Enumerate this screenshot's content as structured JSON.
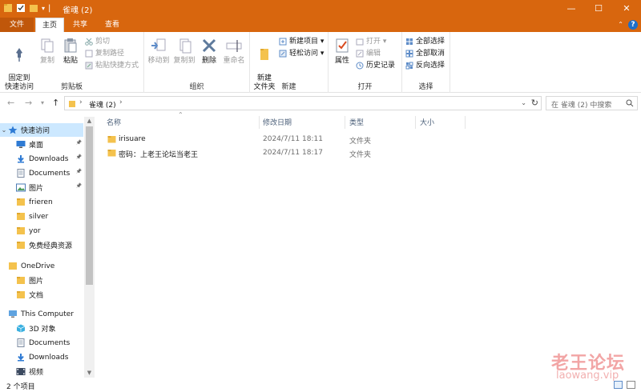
{
  "window": {
    "title": "雀魂 (2)",
    "minimize": "—",
    "maximize": "☐",
    "close": "✕"
  },
  "tabs": [
    "文件",
    "主页",
    "共享",
    "查看"
  ],
  "help": "?",
  "ribbon": {
    "clipboard": {
      "label": "剪贴板",
      "pin": "固定到\n快速访问",
      "copy": "复制",
      "paste": "粘贴",
      "cut": "剪切",
      "copy_path": "复制路径",
      "paste_shortcut": "粘贴快捷方式"
    },
    "organize": {
      "label": "组织",
      "move_to": "移动到",
      "copy_to": "复制到",
      "delete": "删除",
      "rename": "重命名"
    },
    "new": {
      "label": "新建",
      "new_folder": "新建\n文件夹",
      "new_item": "新建项目 ▾",
      "easy_access": "轻松访问 ▾"
    },
    "open": {
      "label": "打开",
      "properties": "属性",
      "open": "打开 ▾",
      "edit": "编辑",
      "history": "历史记录"
    },
    "select": {
      "label": "选择",
      "select_all": "全部选择",
      "select_none": "全部取消",
      "invert": "反向选择"
    }
  },
  "address": {
    "path": "雀魂 (2)",
    "search_placeholder": "在 雀魂 (2) 中搜索"
  },
  "nav": {
    "quick_access": "快速访问",
    "quick_items": [
      {
        "label": "桌面",
        "icon": "desktop-icon",
        "pinned": true
      },
      {
        "label": "Downloads",
        "icon": "download-icon",
        "pinned": true
      },
      {
        "label": "Documents",
        "icon": "documents-icon",
        "pinned": true
      },
      {
        "label": "图片",
        "icon": "pictures-icon",
        "pinned": true
      },
      {
        "label": "frieren",
        "icon": "folder-icon",
        "pinned": false
      },
      {
        "label": "silver",
        "icon": "folder-icon",
        "pinned": false
      },
      {
        "label": "yor",
        "icon": "folder-icon",
        "pinned": false
      },
      {
        "label": "免费经典资源",
        "icon": "folder-icon",
        "pinned": false
      }
    ],
    "onedrive": "OneDrive",
    "onedrive_items": [
      {
        "label": "图片",
        "icon": "folder-icon"
      },
      {
        "label": "文档",
        "icon": "folder-icon"
      }
    ],
    "this_computer": "This Computer",
    "computer_items": [
      {
        "label": "3D 对象",
        "icon": "3d-objects-icon"
      },
      {
        "label": "Documents",
        "icon": "documents-icon"
      },
      {
        "label": "Downloads",
        "icon": "download-icon"
      },
      {
        "label": "视频",
        "icon": "video-icon"
      }
    ]
  },
  "columns": {
    "name": "名称",
    "modified": "修改日期",
    "type": "类型",
    "size": "大小"
  },
  "files": [
    {
      "name": "irisuare",
      "modified": "2024/7/11 18:11",
      "type": "文件夹"
    },
    {
      "name": "密码：上老王论坛当老王",
      "modified": "2024/7/11 18:17",
      "type": "文件夹"
    }
  ],
  "status": {
    "count": "2 个项目"
  },
  "watermark": {
    "cn": "老王论坛",
    "en": "laowang.vip"
  },
  "colors": {
    "accent": "#d8660e",
    "selection": "#cce8ff",
    "folder": "#f4c24d"
  }
}
